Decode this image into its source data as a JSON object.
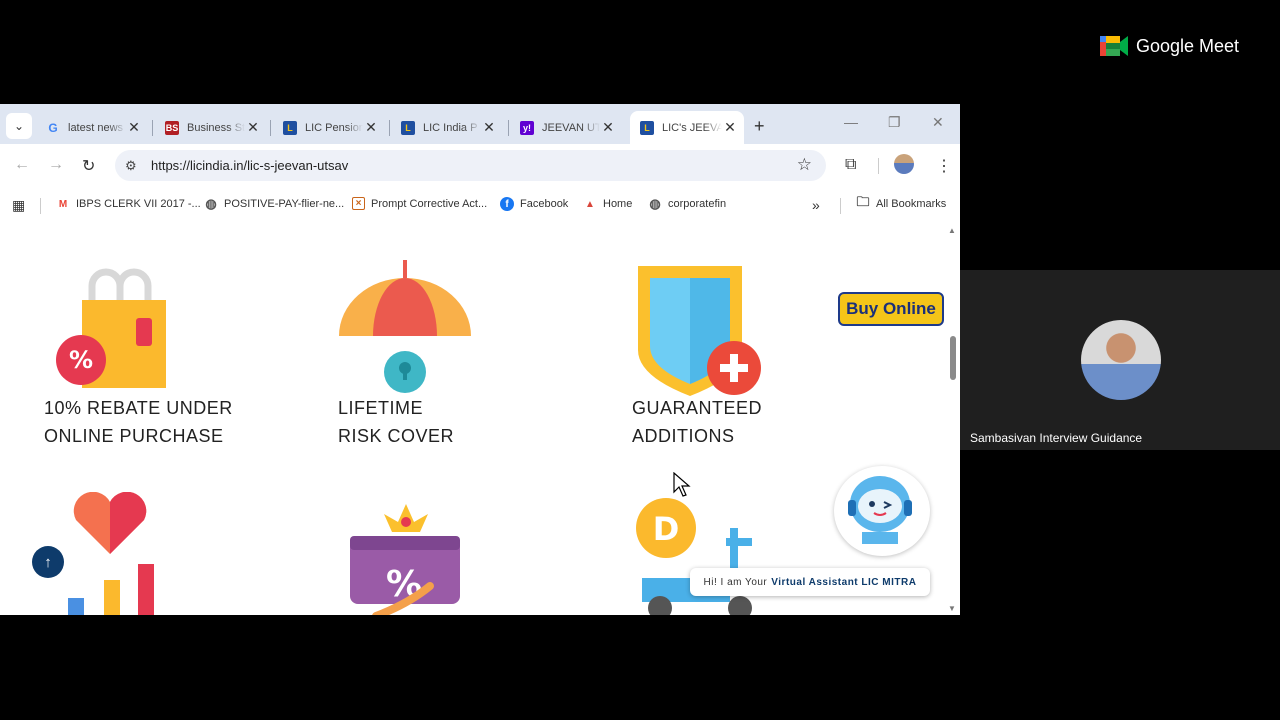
{
  "tabs": [
    {
      "title": "latest news",
      "icon": "google-icon"
    },
    {
      "title": "Business Standard",
      "icon": "business-standard-icon"
    },
    {
      "title": "LIC Pension",
      "icon": "lic-icon"
    },
    {
      "title": "LIC India P",
      "icon": "lic-icon"
    },
    {
      "title": "JEEVAN UT",
      "icon": "yahoo-icon"
    },
    {
      "title": "LIC's JEEVA",
      "icon": "lic-icon",
      "active": true
    }
  ],
  "address_bar": {
    "url": "https://licindia.in/lic-s-jeevan-utsav"
  },
  "bookmarks": [
    {
      "label": "IBPS CLERK VII 2017 -...",
      "icon": "gmail-icon"
    },
    {
      "label": "POSITIVE-PAY-flier-ne...",
      "icon": "globe-icon"
    },
    {
      "label": "Prompt Corrective Act...",
      "icon": "bookmark-site-icon"
    },
    {
      "label": "Facebook",
      "icon": "facebook-icon"
    },
    {
      "label": "Home",
      "icon": "home-site-icon"
    },
    {
      "label": "corporatefin",
      "icon": "globe-icon"
    }
  ],
  "all_bookmarks_label": "All Bookmarks",
  "features": [
    {
      "line1": "10% REBATE UNDER",
      "line2": "ONLINE PURCHASE"
    },
    {
      "line1": "LIFETIME",
      "line2": "RISK COVER"
    },
    {
      "line1": "GUARANTEED",
      "line2": "ADDITIONS"
    }
  ],
  "buy_online_label": "Buy Online",
  "assistant": {
    "greeting": "Hi! I am Your",
    "name": "Virtual Assistant LIC MITRA"
  },
  "meet": {
    "brand": "Google Meet",
    "participant_name": "Sambasivan Interview Guidance"
  },
  "colors": {
    "lic_blue": "#0e3b6b",
    "buy_online_bg": "#f5c518",
    "tab_strip": "#dfe6f2"
  }
}
